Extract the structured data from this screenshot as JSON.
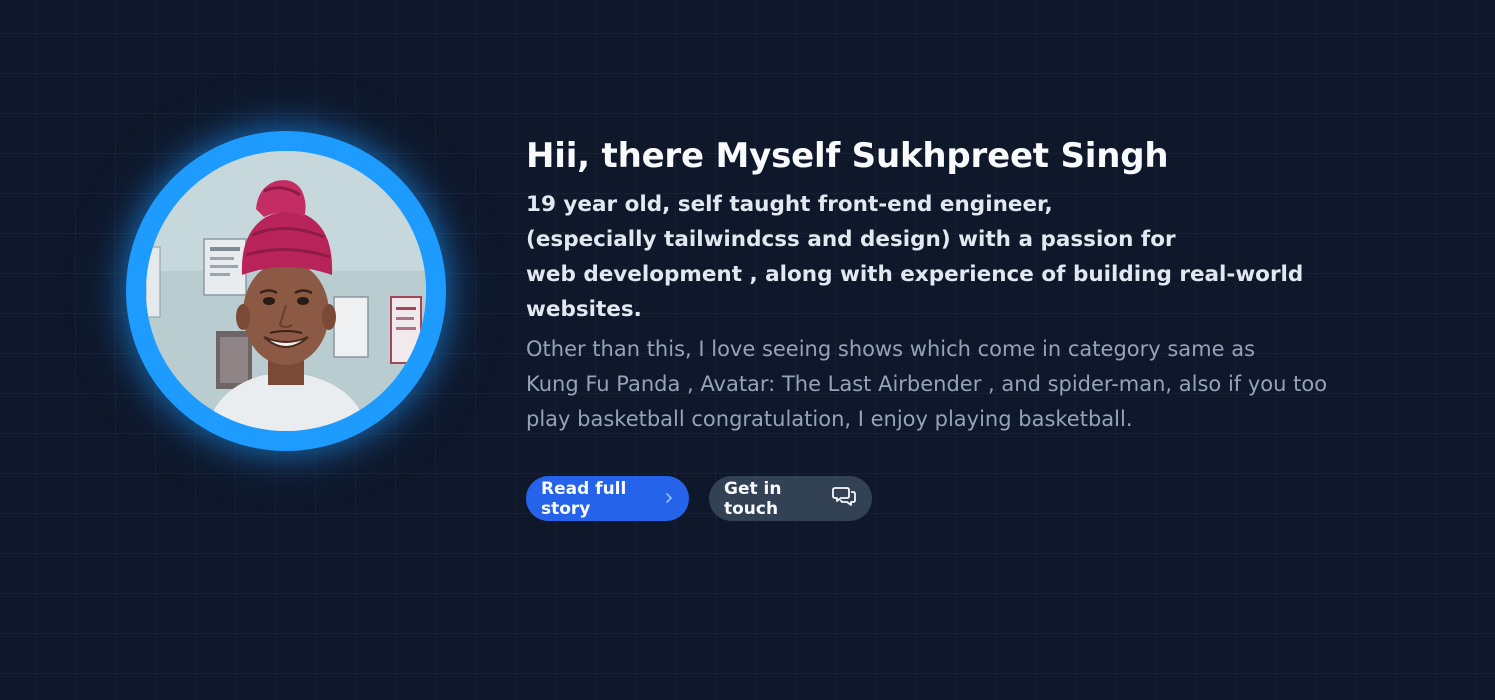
{
  "hero": {
    "title": "Hii, there Myself Sukhpreet Singh",
    "intro_lines": [
      "19 year old, self taught front-end engineer,",
      "(especially tailwindcss and design) with a passion for",
      "web development , along with experience of building real-world",
      "websites."
    ],
    "about_lines": [
      "Other than this, I love seeing shows which come in category same as",
      "Kung Fu Panda , Avatar: The Last Airbender , and spider-man, also if you too",
      "play basketball congratulation, I enjoy playing basketball."
    ]
  },
  "buttons": {
    "primary_label": "Read full story",
    "primary_icon": "chevron-right-icon",
    "secondary_label": "Get in touch",
    "secondary_icon": "chat-bubbles-icon"
  },
  "colors": {
    "background": "#0f172a",
    "ring": "#1e9bff",
    "primary_button": "#2563eb",
    "secondary_button": "#334155",
    "muted_text": "#94a3b8"
  }
}
